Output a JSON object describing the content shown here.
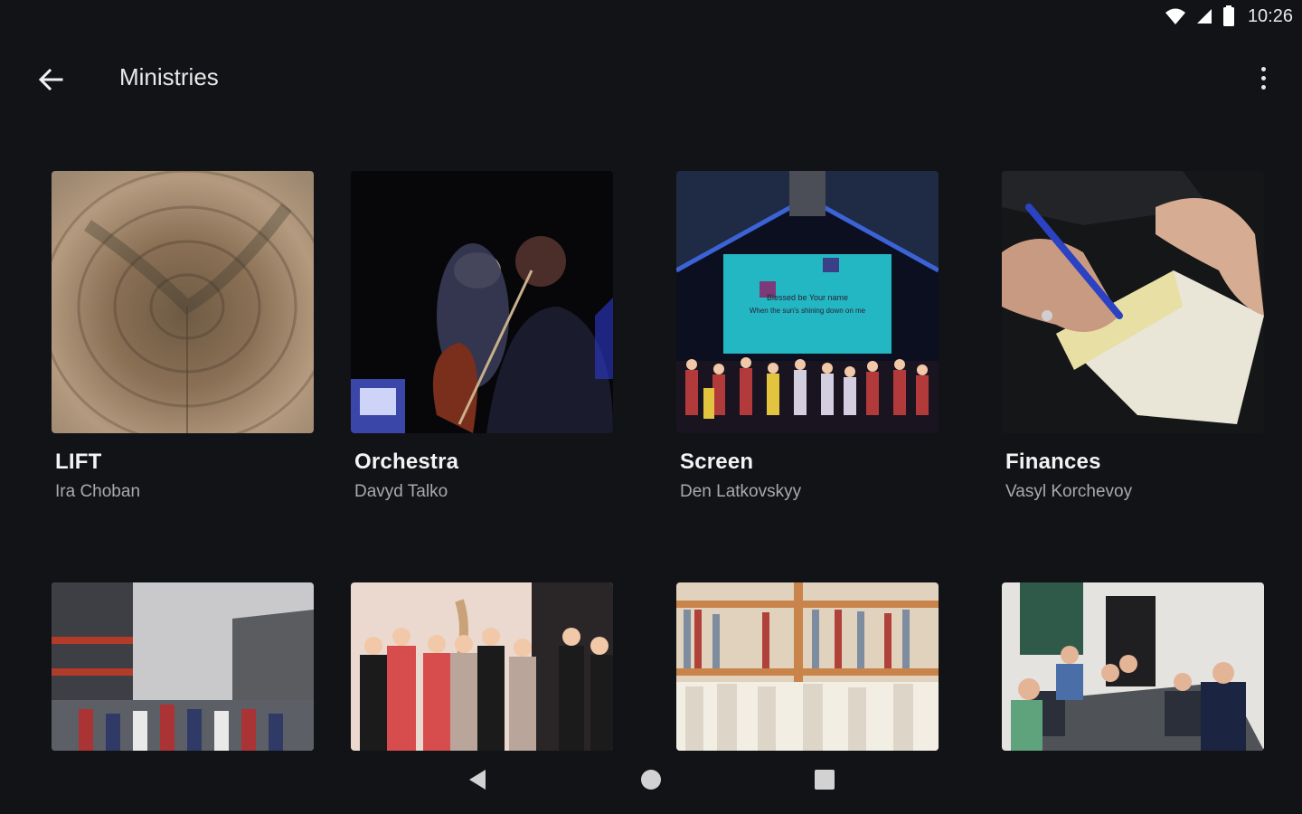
{
  "status": {
    "time": "10:26",
    "icons": [
      "wifi-icon",
      "signal-icon",
      "battery-icon"
    ]
  },
  "app_bar": {
    "title": "Ministries",
    "back_icon": "arrow-left-icon",
    "menu_icon": "more-vertical-icon"
  },
  "ministries": [
    {
      "title": "LIFT",
      "leader": "Ira Choban"
    },
    {
      "title": "Orchestra",
      "leader": "Davyd Talko"
    },
    {
      "title": "Screen",
      "leader": "Den Latkovskyy"
    },
    {
      "title": "Finances",
      "leader": "Vasyl Korchevoy"
    },
    {
      "title": "",
      "leader": ""
    },
    {
      "title": "",
      "leader": ""
    },
    {
      "title": "",
      "leader": ""
    },
    {
      "title": "",
      "leader": ""
    }
  ],
  "screen_lyrics": [
    "Blessed be Your name",
    "When the sun's shining down on me"
  ],
  "nav": {
    "back": "nav-back-icon",
    "home": "nav-home-icon",
    "recents": "nav-recents-icon"
  },
  "colors": {
    "background": "#121316",
    "title_text": "#f3f3f3",
    "subtitle_text": "#a9a9ae"
  }
}
